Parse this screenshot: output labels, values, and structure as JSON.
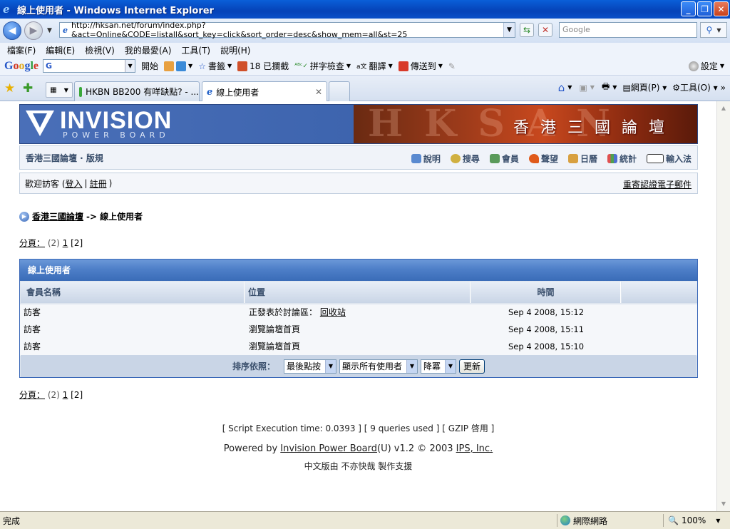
{
  "window": {
    "title": "線上使用者 - Windows Internet Explorer"
  },
  "address": {
    "url": "http://hksan.net/forum/index.php?&act=Online&CODE=listall&sort_key=click&sort_order=desc&show_mem=all&st=25",
    "search_placeholder": "Google"
  },
  "menu": [
    "檔案(F)",
    "編輯(E)",
    "檢視(V)",
    "我的最愛(A)",
    "工具(T)",
    "說明(H)"
  ],
  "google_toolbar": {
    "start": "開始",
    "bookmarks": "書籤",
    "blocked": "18 已攔截",
    "spellcheck": "拼字檢查",
    "translate": "翻譯",
    "sendto": "傳送到",
    "settings": "設定"
  },
  "tabs": [
    {
      "label": "HKBN BB200 有咩缺點? - ..."
    },
    {
      "label": "線上使用者"
    }
  ],
  "command_bar": {
    "page": "網頁(P)",
    "tools": "工具(O)"
  },
  "forum": {
    "logo_text": "INVISION",
    "logo_sub": "POWER BOARD",
    "banner_bg": "HKSAN",
    "banner_title": "香港三國論壇",
    "board_link": "香港三國論壇 · 版規",
    "nav": [
      "說明",
      "搜尋",
      "會員",
      "聲望",
      "日曆",
      "統計",
      "輸入法"
    ],
    "welcome_prefix": "歡迎訪客 (",
    "login": "登入",
    "sep": "|",
    "register": "註冊",
    "welcome_suffix": ")",
    "resend": "重寄認證電子郵件",
    "crumb_home": "香港三國論壇",
    "crumb_sep": "->",
    "crumb_current": "線上使用者",
    "pages_label": "分頁：",
    "pages_count": "(2)",
    "page1": "1",
    "page2": "[2]",
    "table_title": "線上使用者",
    "col_name": "會員名稱",
    "col_location": "位置",
    "col_time": "時間",
    "rows": [
      {
        "name": "訪客",
        "location": "正發表於討論區：",
        "location_link": "回收站",
        "time": "Sep 4 2008, 15:12"
      },
      {
        "name": "訪客",
        "location": "瀏覽論壇首頁",
        "location_link": "",
        "time": "Sep 4 2008, 15:11"
      },
      {
        "name": "訪客",
        "location": "瀏覽論壇首頁",
        "location_link": "",
        "time": "Sep 4 2008, 15:10"
      }
    ],
    "sort_label": "排序依照：",
    "sort_key": "最後點按",
    "show_mem": "顯示所有使用者",
    "sort_order": "降冪",
    "update_btn": "更新",
    "exec_info": "[ Script Execution time: 0.0393 ]  [ 9 queries used ]  [ GZIP 啓用 ]",
    "powered_prefix": "Powered by ",
    "powered_link": "Invision Power Board",
    "powered_mid": "(U) v1.2 © 2003  ",
    "ips": "IPS, Inc.",
    "cn_version": "中文版由 不亦快哉 製作支援"
  },
  "status": {
    "text": "完成",
    "zone": "網際網路",
    "zoom": "100%"
  },
  "colors": {
    "header_blue": "#3a6cb8",
    "titlebar": "#0542b8",
    "nav_text": "#3a4f6c"
  }
}
